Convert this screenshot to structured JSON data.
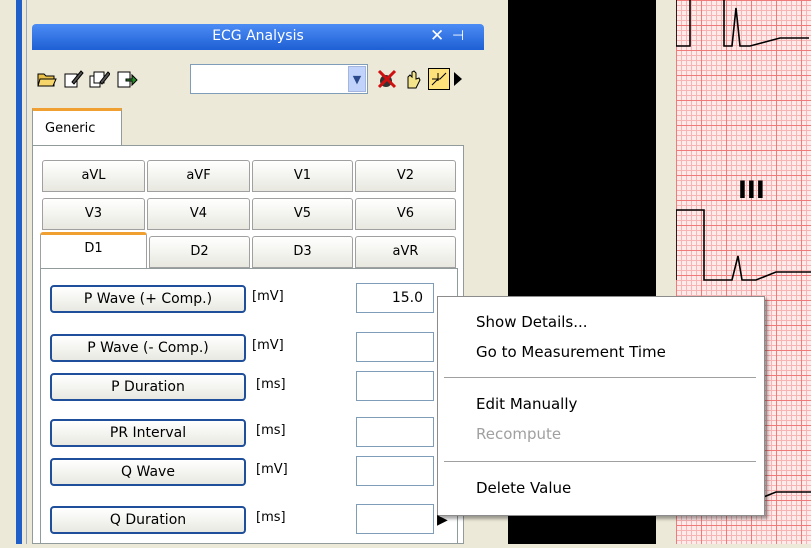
{
  "window": {
    "title": "ECG Analysis"
  },
  "toolbar": {
    "icons": [
      "open-icon",
      "edit-icon",
      "edit-all-icon",
      "export-icon",
      "delete-marker-icon",
      "hand-icon",
      "wave-icon",
      "more-icon"
    ],
    "combo_value": ""
  },
  "tabs": {
    "generic": "Generic",
    "leads_row1": [
      "aVL",
      "aVF",
      "V1",
      "V2"
    ],
    "leads_row2": [
      "V3",
      "V4",
      "V5",
      "V6"
    ],
    "leads_row3": [
      "D1",
      "D2",
      "D3",
      "aVR"
    ],
    "active": "D1"
  },
  "measurements": [
    {
      "label": "P Wave (+ Comp.)",
      "unit": "[mV]",
      "value": "15.0"
    },
    {
      "label": "P Wave (- Comp.)",
      "unit": "[mV]",
      "value": ""
    },
    {
      "label": "P Duration",
      "unit": "[ms]",
      "value": ""
    },
    {
      "label": "PR Interval",
      "unit": "[ms]",
      "value": ""
    },
    {
      "label": "Q Wave",
      "unit": "[mV]",
      "value": ""
    },
    {
      "label": "Q Duration",
      "unit": "[ms]",
      "value": ""
    }
  ],
  "ecg": {
    "lead_label": "III"
  },
  "context_menu": {
    "items": [
      {
        "label": "Show Details...",
        "enabled": true
      },
      {
        "label": "Go to Measurement Time",
        "enabled": true
      },
      {
        "label": "Edit Manually",
        "enabled": true
      },
      {
        "label": "Recompute",
        "enabled": false
      },
      {
        "label": "Delete Value",
        "enabled": true
      }
    ]
  },
  "colors": {
    "title_bar": "#1e5fd4",
    "tab_accent": "#f0a030",
    "ecg_grid": "#f07a7a",
    "ecg_trace": "#000000"
  }
}
